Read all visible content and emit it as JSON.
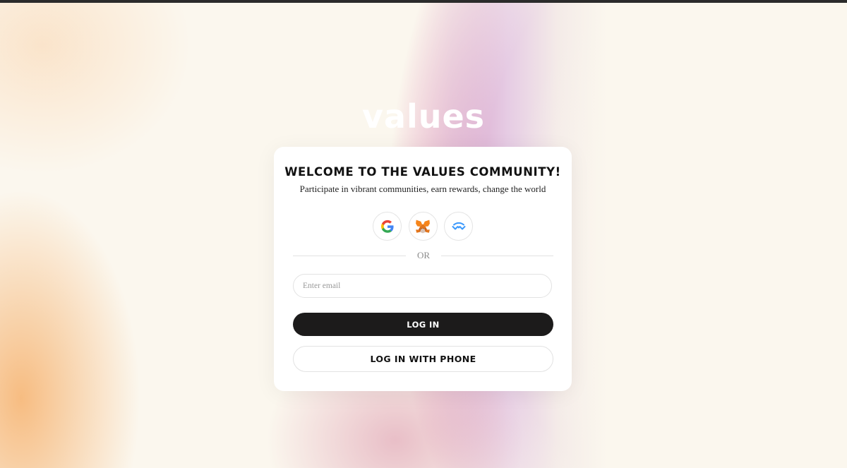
{
  "brand": {
    "logo_text": "values"
  },
  "card": {
    "title": "WELCOME TO THE VALUES COMMUNITY!",
    "subtitle": "Participate in vibrant communities, earn rewards, change the world"
  },
  "social_login": [
    {
      "name": "google",
      "icon": "google-icon"
    },
    {
      "name": "metamask",
      "icon": "metamask-fox-icon"
    },
    {
      "name": "walletconnect",
      "icon": "walletconnect-icon"
    }
  ],
  "divider": {
    "text": "OR"
  },
  "email": {
    "placeholder": "Enter email",
    "value": ""
  },
  "buttons": {
    "login_label": "LOG IN",
    "phone_login_label": "LOG IN WITH PHONE"
  },
  "colors": {
    "background": "#fbf7ee",
    "primary_button": "#1c1b1b",
    "card": "#ffffff",
    "gradient_orange": "#f2843c",
    "gradient_red": "#f0503e",
    "gradient_pink": "#e36d9c",
    "gradient_lavender": "#d8a0c8"
  }
}
